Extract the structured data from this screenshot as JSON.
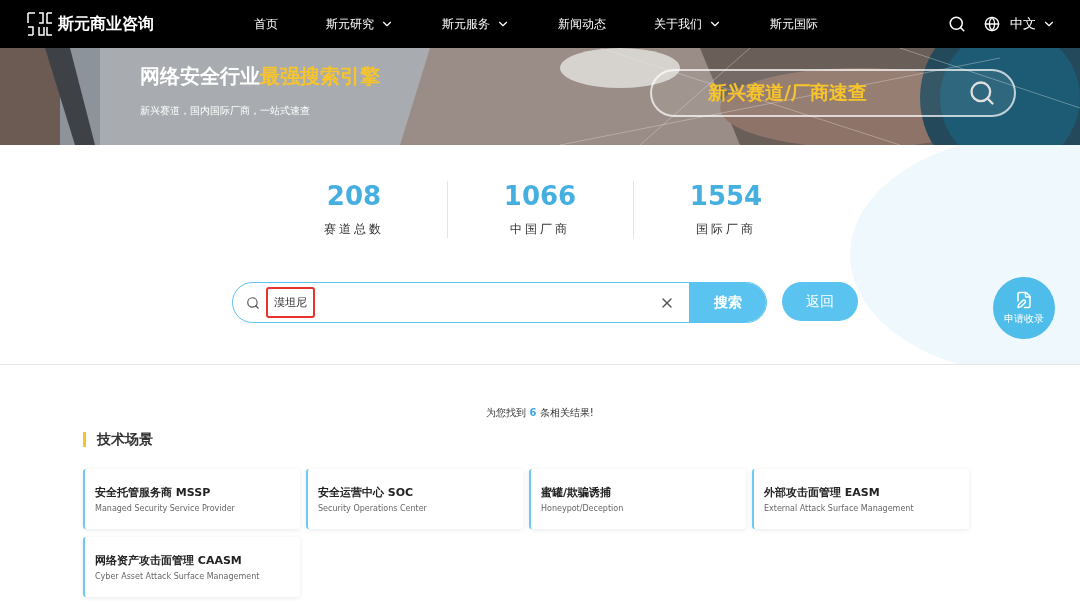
{
  "header": {
    "logo": "斯元商业咨询",
    "nav": [
      {
        "label": "首页",
        "has_menu": false
      },
      {
        "label": "斯元研究",
        "has_menu": true
      },
      {
        "label": "斯元服务",
        "has_menu": true
      },
      {
        "label": "新闻动态",
        "has_menu": false
      },
      {
        "label": "关于我们",
        "has_menu": true
      },
      {
        "label": "斯元国际",
        "has_menu": false
      }
    ],
    "language": "中文"
  },
  "banner": {
    "title": "网络安全行业",
    "title_highlight": "最强搜索引擎",
    "subtitle": "新兴赛道，国内国际厂商，一站式速查",
    "quick_search": "新兴赛道/厂商速查"
  },
  "stats": [
    {
      "value": "208",
      "label": "赛道总数"
    },
    {
      "value": "1066",
      "label": "中国厂商"
    },
    {
      "value": "1554",
      "label": "国际厂商"
    }
  ],
  "search": {
    "value": "漠坦尼",
    "highlighted": true,
    "submit": "搜索",
    "back": "返回"
  },
  "apply_button": "申请收录",
  "results": {
    "prefix": "为您找到",
    "count": "6",
    "suffix": "条相关结果!"
  },
  "section": {
    "title": "技术场景",
    "cards": [
      {
        "title": "安全托管服务商 MSSP",
        "subtitle": "Managed Security Service Provider"
      },
      {
        "title": "安全运营中心 SOC",
        "subtitle": "Security Operations Center"
      },
      {
        "title": "蜜罐/欺骗诱捕",
        "subtitle": "Honeypot/Deception"
      },
      {
        "title": "外部攻击面管理 EASM",
        "subtitle": "External Attack Surface Management"
      },
      {
        "title": "网络资产攻击面管理 CAASM",
        "subtitle": "Cyber Asset Attack Surface Management"
      }
    ]
  }
}
